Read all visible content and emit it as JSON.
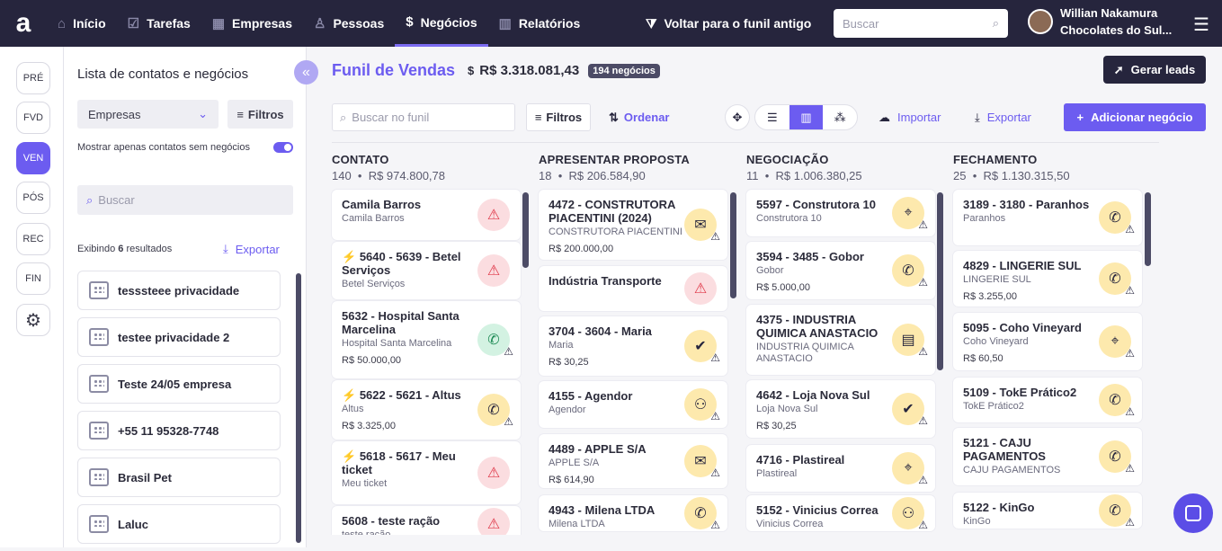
{
  "topbar": {
    "logo": "a",
    "nav": [
      {
        "label": "Início",
        "icon": "home-icon",
        "glyph": "⌂"
      },
      {
        "label": "Tarefas",
        "icon": "check-icon",
        "glyph": "☑"
      },
      {
        "label": "Empresas",
        "icon": "building-icon",
        "glyph": "▦"
      },
      {
        "label": "Pessoas",
        "icon": "person-icon",
        "glyph": "♙"
      },
      {
        "label": "Negócios",
        "icon": "dollar-icon",
        "glyph": "$"
      },
      {
        "label": "Relatórios",
        "icon": "chart-icon",
        "glyph": "▥"
      }
    ],
    "back_funnel": "Voltar para o funil antigo",
    "search_placeholder": "Buscar",
    "user_name": "Willian Nakamura",
    "company": "Chocolates do Sul..."
  },
  "rail": [
    "PRÉ",
    "FVD",
    "VEN",
    "PÓS",
    "REC",
    "FIN"
  ],
  "panel": {
    "title": "Lista de contatos e negócios",
    "select_value": "Empresas",
    "filters_label": "Filtros",
    "toggle_label": "Mostrar apenas contatos sem negócios",
    "search_placeholder": "Buscar",
    "results_prefix": "Exibindo ",
    "results_count": "6",
    "results_suffix": " resultados",
    "export_label": "Exportar",
    "companies": [
      "tesssteee privacidade",
      "testee privacidade 2",
      "Teste 24/05 empresa",
      "+55 11 95328-7748",
      "Brasil Pet",
      "Laluc"
    ]
  },
  "funnel": {
    "title": "Funil de Vendas",
    "total": "R$ 3.318.081,43",
    "deals_badge": "194 negócios",
    "generate_leads": "Gerar leads",
    "search_placeholder": "Buscar no funil",
    "filters_label": "Filtros",
    "sort_label": "Ordenar",
    "import_label": "Importar",
    "export_label": "Exportar",
    "add_label": "Adicionar negócio"
  },
  "accent_color": "#6c5cf0",
  "columns": [
    {
      "title": "CONTATO",
      "count": "140",
      "total": "R$ 974.800,78",
      "cards": [
        {
          "title": "Camila Barros",
          "subtitle": "Camila Barros",
          "value": "",
          "bolt": false,
          "icon": "warning-icon",
          "tone": "red"
        },
        {
          "title": "5640 - 5639 - Betel Serviços",
          "subtitle": "Betel Serviços",
          "value": "",
          "bolt": true,
          "icon": "warning-icon",
          "tone": "red"
        },
        {
          "title": "5632 - Hospital Santa Marcelina",
          "subtitle": "Hospital Santa Marcelina",
          "value": "R$ 50.000,00",
          "bolt": false,
          "icon": "phone-calendar-icon",
          "tone": "grn"
        },
        {
          "title": "5622 - 5621 - Altus",
          "subtitle": "Altus",
          "value": "R$ 3.325,00",
          "bolt": true,
          "icon": "phone-icon",
          "tone": "yel"
        },
        {
          "title": "5618 - 5617 - Meu ticket",
          "subtitle": "Meu ticket",
          "value": "",
          "bolt": true,
          "icon": "warning-icon",
          "tone": "red"
        },
        {
          "title": "5608 - teste ração",
          "subtitle": "teste ração",
          "value": "",
          "bolt": false,
          "icon": "warning-icon",
          "tone": "red"
        }
      ]
    },
    {
      "title": "APRESENTAR PROPOSTA",
      "count": "18",
      "total": "R$ 206.584,90",
      "cards": [
        {
          "title": "4472 - CONSTRUTORA PIACENTINI (2024)",
          "subtitle": "CONSTRUTORA PIACENTINI",
          "value": "R$ 200.000,00",
          "bolt": false,
          "icon": "mail-icon",
          "tone": "yel"
        },
        {
          "title": "Indústria Transporte",
          "subtitle": "",
          "value": "",
          "bolt": false,
          "icon": "warning-icon",
          "tone": "red"
        },
        {
          "title": "3704 - 3604 - Maria",
          "subtitle": "Maria",
          "value": "R$ 30,25",
          "bolt": false,
          "icon": "task-icon",
          "tone": "yel"
        },
        {
          "title": "4155 - Agendor",
          "subtitle": "Agendor",
          "value": "",
          "bolt": false,
          "icon": "people-icon",
          "tone": "yel"
        },
        {
          "title": "4489 - APPLE S/A",
          "subtitle": "APPLE S/A",
          "value": "R$ 614,90",
          "bolt": false,
          "icon": "mail-icon",
          "tone": "yel"
        },
        {
          "title": "4943 - Milena LTDA",
          "subtitle": "Milena LTDA",
          "value": "",
          "bolt": false,
          "icon": "phone-icon",
          "tone": "yel"
        }
      ]
    },
    {
      "title": "NEGOCIAÇÃO",
      "count": "11",
      "total": "R$ 1.006.380,25",
      "cards": [
        {
          "title": "5597 - Construtora 10",
          "subtitle": "Construtora 10",
          "value": "",
          "bolt": false,
          "icon": "pin-icon",
          "tone": "yel"
        },
        {
          "title": "3594 - 3485 - Gobor",
          "subtitle": "Gobor",
          "value": "R$ 5.000,00",
          "bolt": false,
          "icon": "phone-icon",
          "tone": "yel"
        },
        {
          "title": "4375 - INDUSTRIA QUIMICA ANASTACIO",
          "subtitle": "INDUSTRIA QUIMICA ANASTACIO",
          "value": "",
          "bolt": false,
          "icon": "document-icon",
          "tone": "yel"
        },
        {
          "title": "4642 - Loja Nova Sul",
          "subtitle": "Loja Nova Sul",
          "value": "R$ 30,25",
          "bolt": false,
          "icon": "task-icon",
          "tone": "yel"
        },
        {
          "title": "4716 - Plastireal",
          "subtitle": "Plastireal",
          "value": "",
          "bolt": false,
          "icon": "pin-icon",
          "tone": "yel"
        },
        {
          "title": "5152 - Vinicius Correa",
          "subtitle": "Vinicius Correa",
          "value": "",
          "bolt": false,
          "icon": "people-icon",
          "tone": "yel"
        }
      ]
    },
    {
      "title": "FECHAMENTO",
      "count": "25",
      "total": "R$ 1.130.315,50",
      "cards": [
        {
          "title": "3189 - 3180 - Paranhos",
          "subtitle": "Paranhos",
          "value": "",
          "bolt": false,
          "icon": "phone-icon",
          "tone": "yel"
        },
        {
          "title": "4829 - LINGERIE SUL",
          "subtitle": "LINGERIE SUL",
          "value": "R$ 3.255,00",
          "bolt": false,
          "icon": "phone-icon",
          "tone": "yel"
        },
        {
          "title": "5095 - Coho Vineyard",
          "subtitle": "Coho Vineyard",
          "value": "R$ 60,50",
          "bolt": false,
          "icon": "pin-icon",
          "tone": "yel"
        },
        {
          "title": "5109 - TokE Prático2",
          "subtitle": "TokE Prático2",
          "value": "",
          "bolt": false,
          "icon": "phone-icon",
          "tone": "yel"
        },
        {
          "title": "5121 - CAJU PAGAMENTOS",
          "subtitle": "CAJU PAGAMENTOS",
          "value": "",
          "bolt": false,
          "icon": "phone-icon",
          "tone": "yel"
        },
        {
          "title": "5122 - KinGo",
          "subtitle": "KinGo",
          "value": "",
          "bolt": false,
          "icon": "phone-icon",
          "tone": "yel"
        }
      ]
    }
  ]
}
